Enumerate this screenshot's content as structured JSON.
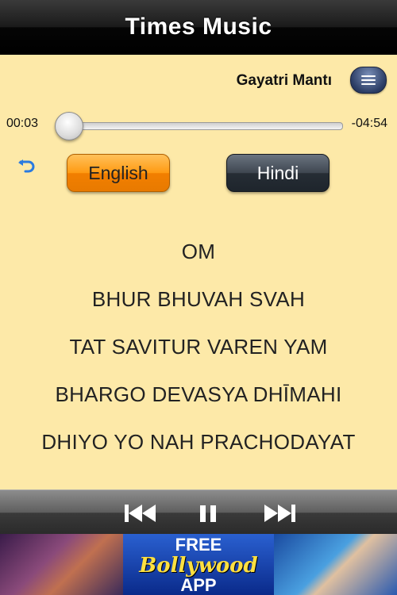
{
  "app": {
    "title": "Times Music"
  },
  "player": {
    "song_title": "Gayatri Mantı",
    "elapsed": "00:03",
    "remaining": "-04:54",
    "progress": 0.01
  },
  "language": {
    "english_label": "English",
    "hindi_label": "Hindi",
    "selected": "English"
  },
  "lyrics": [
    "OM",
    "BHUR BHUVAH SVAH",
    "TAT SAVITUR  VAREN YAM",
    "BHARGO DEVASYA DHĪMAHI",
    "DHIYO YO NAH PRACHODAYAT"
  ],
  "ad": {
    "line1": "FREE",
    "line2": "Bollywood",
    "line3": "APP"
  },
  "colors": {
    "accent_orange": "#ff9a12",
    "background": "#fde9a8",
    "dark_button": "#3e4650"
  },
  "icons": [
    "list-icon",
    "back-arrow-icon",
    "previous-track-icon",
    "pause-icon",
    "next-track-icon"
  ]
}
